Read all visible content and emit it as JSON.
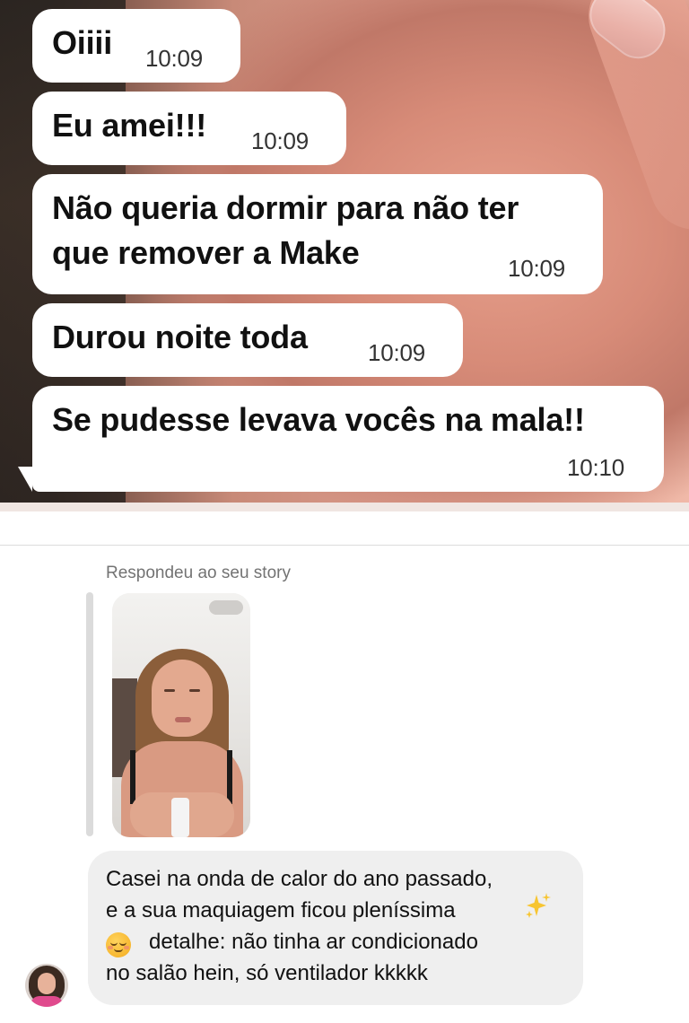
{
  "whatsapp": {
    "messages": [
      {
        "text": "Oiiii",
        "time": "10:09"
      },
      {
        "text": "Eu amei!!!",
        "time": "10:09"
      },
      {
        "text_lines": [
          "Não queria dormir para não ter",
          "que remover a Make"
        ],
        "time": "10:09"
      },
      {
        "text": "Durou noite toda",
        "time": "10:09"
      },
      {
        "text": "Se pudesse levava vocês na mala!!",
        "time": "10:10"
      }
    ]
  },
  "instagram": {
    "replied_label": "Respondeu ao seu story",
    "message_lines": [
      "Casei na onda de calor do ano passado,",
      "e a sua maquiagem ficou pleníssima",
      "detalhe: não tinha ar condicionado",
      "no salão hein, só ventilador kkkkk"
    ],
    "emojis": [
      "sparkles-icon",
      "relieved-face-icon"
    ]
  },
  "colors": {
    "bubble_bg": "#ffffff",
    "ig_bubble_bg": "#efefef",
    "muted_text": "#737373"
  }
}
